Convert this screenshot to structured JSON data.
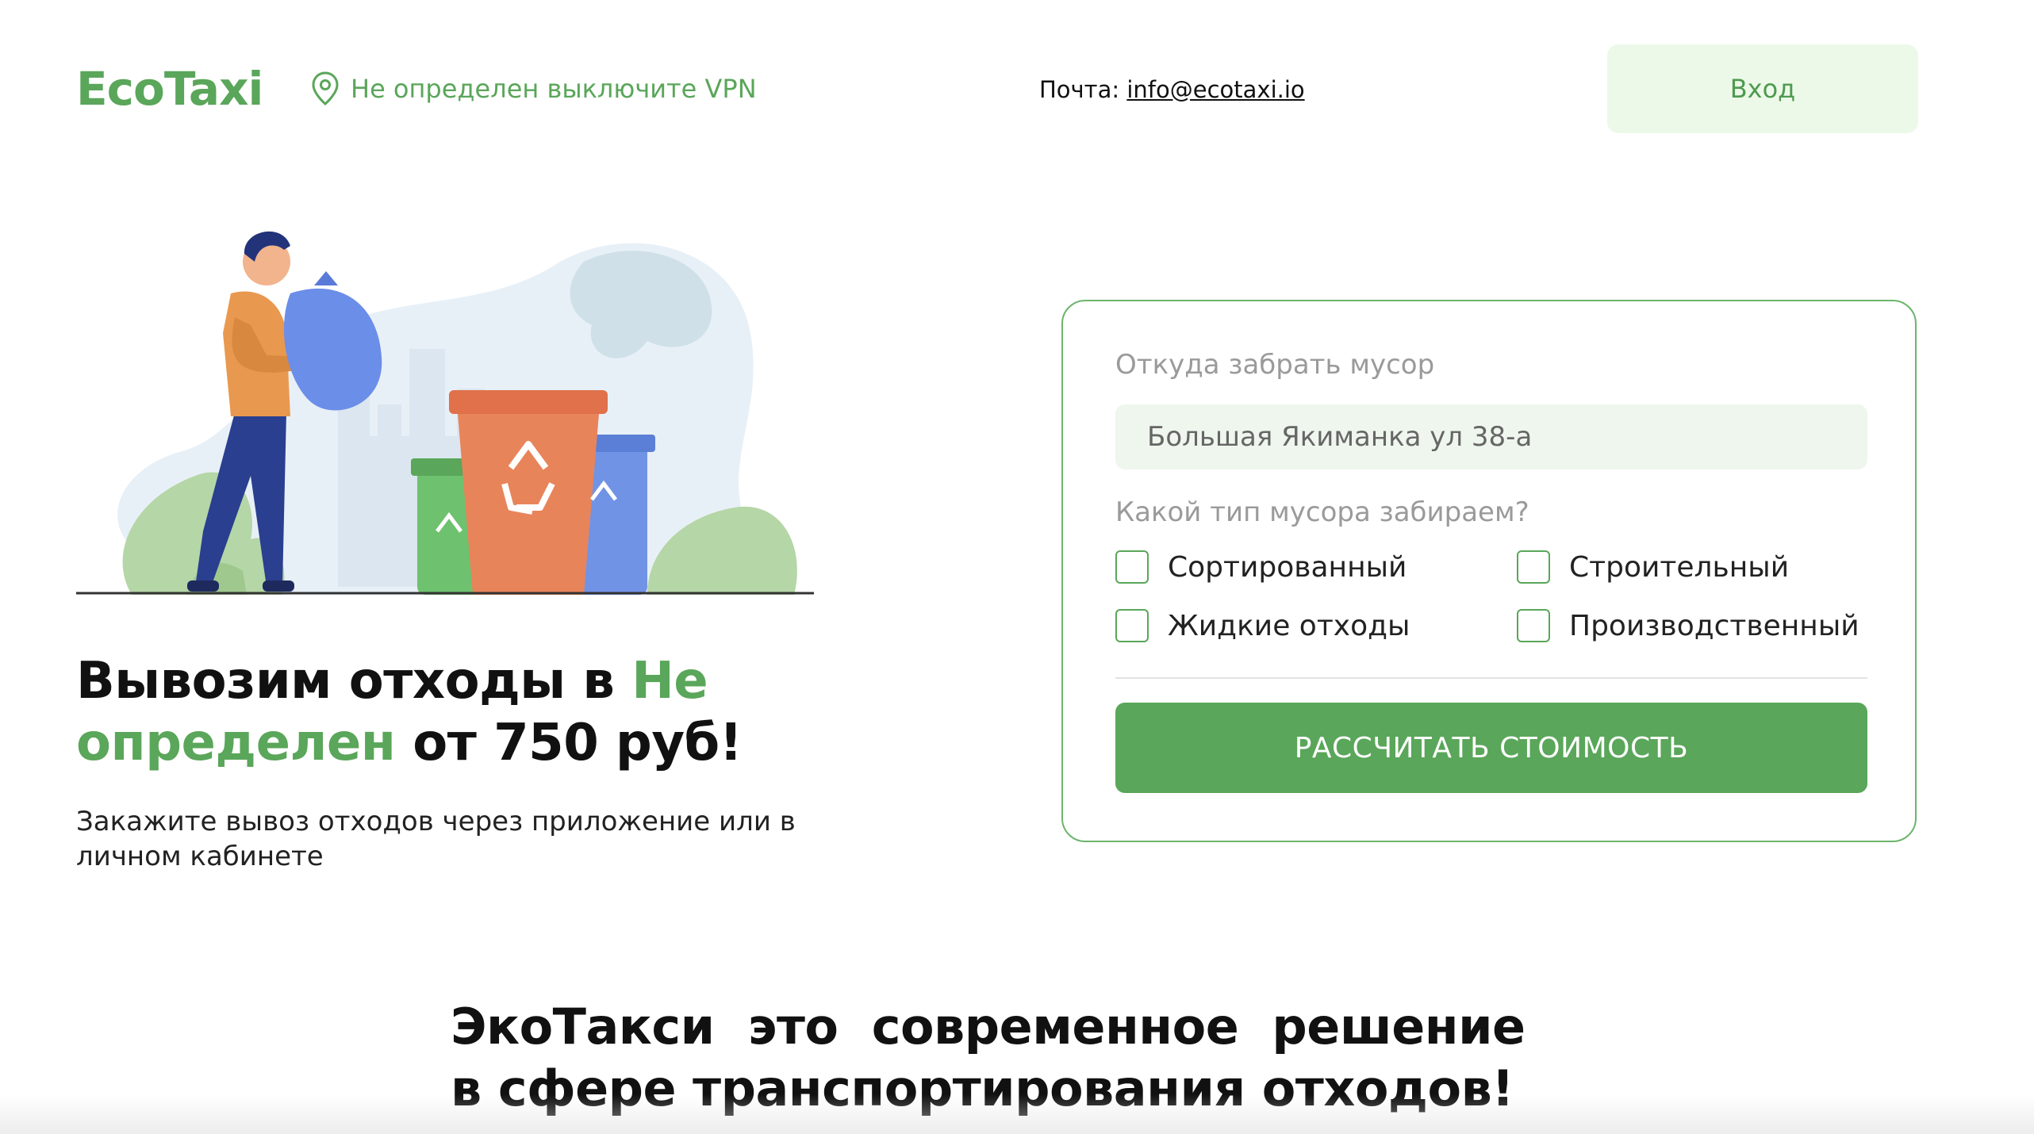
{
  "header": {
    "logo": "EcoTaxi",
    "location_text": "Не определен выключите VPN",
    "mail_label": "Почта:",
    "mail_address": "info@ecotaxi.io",
    "login_label": "Вход"
  },
  "hero": {
    "headline_part1": "Вывозим отходы в ",
    "headline_highlight": "Не определен",
    "headline_part2": " от 750 руб!",
    "subtitle": "Закажите вывоз отходов через приложение или в личном кабинете"
  },
  "form": {
    "address_label": "Откуда забрать мусор",
    "address_value": "Большая Якиманка ул 38-а",
    "type_label": "Какой тип мусора забираем?",
    "options": [
      {
        "label": "Сортированный",
        "checked": false
      },
      {
        "label": "Строительный",
        "checked": false
      },
      {
        "label": "Жидкие отходы",
        "checked": false
      },
      {
        "label": "Производственный",
        "checked": false
      }
    ],
    "submit_label": "РАССЧИТАТЬ СТОИМОСТЬ"
  },
  "bottom": {
    "line1": "ЭкоТакси  это  современное  решение",
    "line2": "в сфере транспортирования отходов!"
  },
  "colors": {
    "accent": "#5aa65a",
    "login_bg": "#ecf9e9",
    "field_bg": "#eff6ee"
  }
}
